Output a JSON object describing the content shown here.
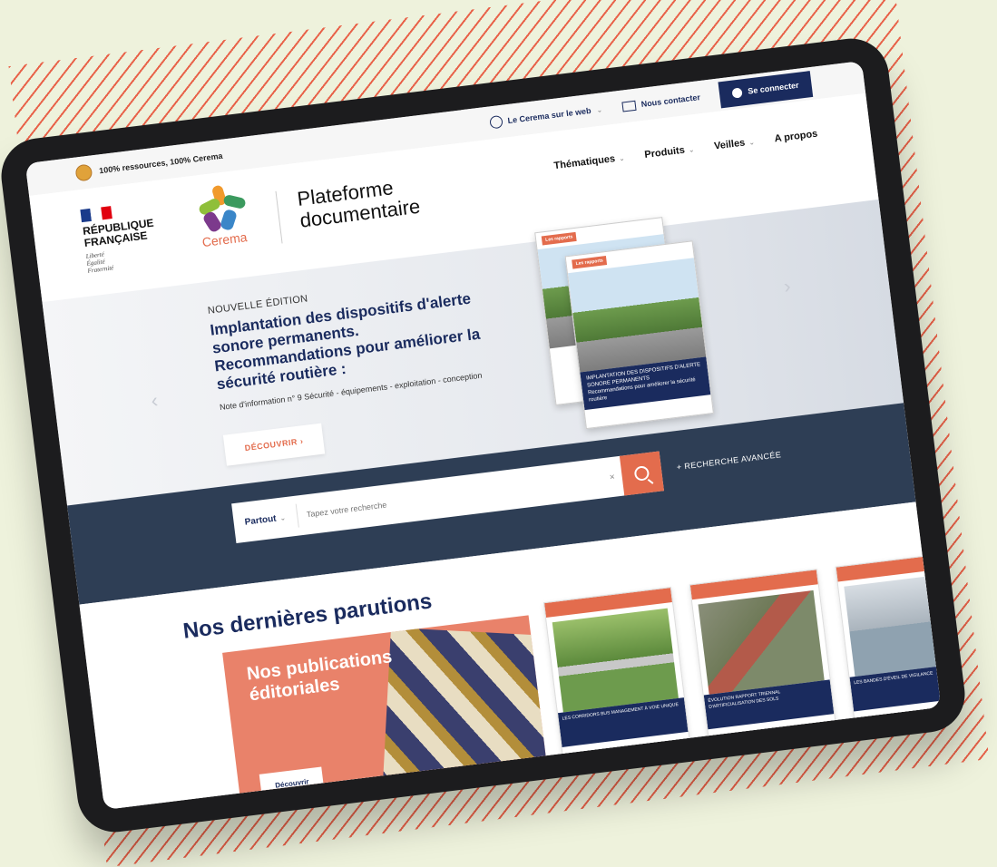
{
  "tagline": "100% ressources, 100% Cerema",
  "top_links": {
    "web": "Le Cerema sur le web",
    "contact": "Nous contacter",
    "login": "Se connecter"
  },
  "brand": {
    "republic_line1": "RÉPUBLIQUE",
    "republic_line2": "FRANÇAISE",
    "motto1": "Liberté",
    "motto2": "Égalité",
    "motto3": "Fraternité",
    "cerema": "Cerema",
    "platform_line1": "Plateforme",
    "platform_line2": "documentaire"
  },
  "nav": [
    "Thématiques",
    "Produits",
    "Veilles",
    "A propos"
  ],
  "hero": {
    "eyebrow": "NOUVELLE ÉDITION",
    "title": "Implantation des dispositifs d'alerte sonore permanents. Recommandations pour améliorer la sécurité routière :",
    "subtitle": "Note d'information n° 9 Sécurité - équipements - exploitation - conception",
    "cta": "DÉCOUVRIR",
    "cover_tag": "Les rapports",
    "cover_band1": "IMPLANTATION DES DISPOSITIFS D'ALERTE SONORE PERMANENTS",
    "cover_band2": "Recommandations pour améliorer la sécurité routière"
  },
  "search": {
    "scope": "Partout",
    "placeholder": "Tapez votre recherche",
    "advanced": "+ RECHERCHE AVANCÉE"
  },
  "latest": {
    "title": "Nos dernières parutions",
    "promo_line1": "Nos publications",
    "promo_line2": "éditoriales",
    "promo_button": "Découvrir",
    "pubs": [
      {
        "band": "LES CORRIDORS BUS MANAGEMENT À VOIE UNIQUE"
      },
      {
        "band": "ÉVOLUTION RAPPORT TRIENNAL D'ARTIFICIALISATION DES SOLS"
      },
      {
        "band": "LES BANDES D'ÉVEIL DE VIGILANCE"
      }
    ]
  },
  "colors": {
    "navy": "#1a2b5e",
    "accent": "#e36c4d",
    "search_band": "#2e3e55",
    "background": "#eef2dc"
  }
}
